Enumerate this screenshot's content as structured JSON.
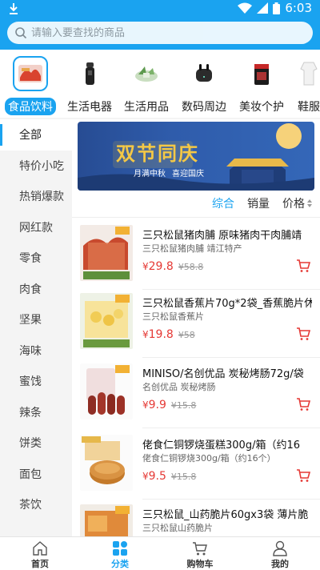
{
  "status_bar": {
    "time": "6:03"
  },
  "search": {
    "placeholder": "请输入要查找的商品"
  },
  "categories": [
    {
      "label": "食品饮料",
      "icon": "snack-food-icon",
      "active": true
    },
    {
      "label": "生活电器",
      "icon": "shaver-icon"
    },
    {
      "label": "生活用品",
      "icon": "green-goods-icon"
    },
    {
      "label": "数码周边",
      "icon": "earbuds-icon"
    },
    {
      "label": "美妆个护",
      "icon": "cosmetics-icon"
    },
    {
      "label": "鞋服",
      "icon": "clothing-icon"
    }
  ],
  "sidebar": {
    "items": [
      {
        "label": "全部",
        "active": true
      },
      {
        "label": "特价小吃"
      },
      {
        "label": "热销爆款"
      },
      {
        "label": "网红款"
      },
      {
        "label": "零食"
      },
      {
        "label": "肉食"
      },
      {
        "label": "坚果"
      },
      {
        "label": "海味"
      },
      {
        "label": "蜜饯"
      },
      {
        "label": "辣条"
      },
      {
        "label": "饼类"
      },
      {
        "label": "面包"
      },
      {
        "label": "茶饮"
      }
    ]
  },
  "banner": {
    "title": "双节同庆",
    "line1": "月满中秋",
    "line2": "喜迎国庆"
  },
  "sort": {
    "comprehensive": "综合",
    "sales": "销量",
    "price": "价格"
  },
  "products": [
    {
      "title": "三只松鼠猪肉脯 原味猪肉干肉脯靖",
      "subtitle": "三只松鼠猪肉脯 靖江特产",
      "currency": "¥",
      "price": "29.8",
      "old_price": "¥58.8"
    },
    {
      "title": "三只松鼠香蕉片70g*2袋_香蕉脆片休",
      "subtitle": "三只松鼠香蕉片",
      "currency": "¥",
      "price": "19.8",
      "old_price": "¥58"
    },
    {
      "title": "MINISO/名创优品 炭秘烤肠72g/袋",
      "subtitle": "名创优品 炭秘烤肠",
      "currency": "¥",
      "price": "9.9",
      "old_price": "¥15.8"
    },
    {
      "title": "佬食仁铜锣烧蛋糕300g/箱（约16",
      "subtitle": "佬食仁铜锣烧300g/箱（约16个）",
      "currency": "¥",
      "price": "9.5",
      "old_price": "¥15.8"
    },
    {
      "title": "三只松鼠_山药脆片60gx3袋 薄片脆",
      "subtitle": "三只松鼠山药脆片",
      "currency": "¥",
      "price": "",
      "old_price": ""
    }
  ],
  "bottom_nav": [
    {
      "label": "首页",
      "icon": "home-icon"
    },
    {
      "label": "分类",
      "icon": "category-icon",
      "active": true
    },
    {
      "label": "购物车",
      "icon": "cart-icon"
    },
    {
      "label": "我的",
      "icon": "profile-icon"
    }
  ],
  "colors": {
    "accent": "#1aa3f0",
    "price": "#e53935"
  }
}
